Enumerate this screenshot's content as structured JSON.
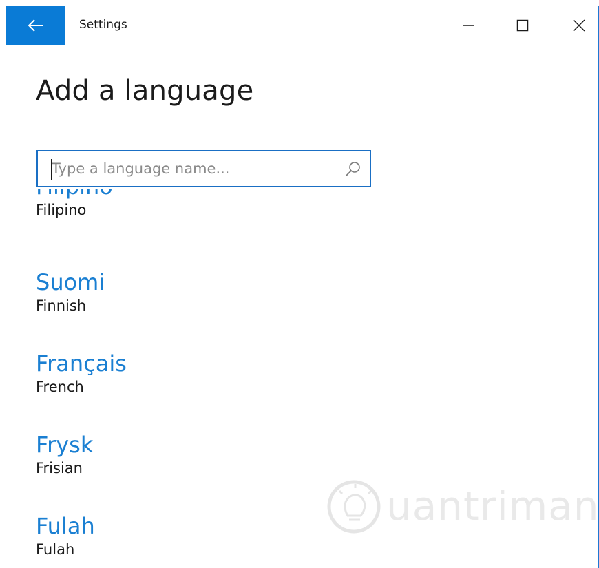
{
  "window": {
    "title": "Settings",
    "accent": "#0a7bd6",
    "back_icon": "arrow-left-icon",
    "minimize_icon": "minimize-icon",
    "maximize_icon": "maximize-icon",
    "close_icon": "close-icon"
  },
  "page": {
    "title": "Add a language"
  },
  "search": {
    "placeholder": "Type a language name...",
    "value": "",
    "icon": "search-icon"
  },
  "languages": [
    {
      "native": "Filipino",
      "english": "Filipino"
    },
    {
      "native": "Suomi",
      "english": "Finnish"
    },
    {
      "native": "Français",
      "english": "French"
    },
    {
      "native": "Frysk",
      "english": "Frisian"
    },
    {
      "native": "Fulah",
      "english": "Fulah"
    }
  ],
  "watermark": {
    "text": "uantrimang",
    "icon": "lightbulb-icon"
  },
  "colors": {
    "link_blue": "#1a7fd2",
    "search_border": "#1a6fc4",
    "text": "#1b1b1b"
  }
}
